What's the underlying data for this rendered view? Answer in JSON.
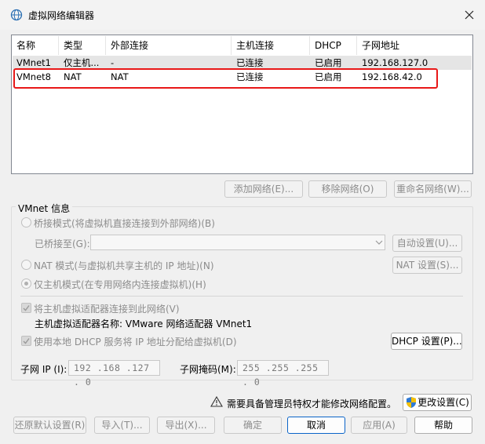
{
  "window": {
    "title": "虚拟网络编辑器"
  },
  "table": {
    "headers": [
      "名称",
      "类型",
      "外部连接",
      "主机连接",
      "DHCP",
      "子网地址"
    ],
    "rows": [
      [
        "VMnet1",
        "仅主机...",
        "-",
        "已连接",
        "已启用",
        "192.168.127.0"
      ],
      [
        "VMnet8",
        "NAT",
        "NAT",
        "已连接",
        "已启用",
        "192.168.42.0"
      ]
    ]
  },
  "table_buttons": {
    "add": "添加网络(E)...",
    "remove": "移除网络(O)",
    "rename": "重命名网络(W)..."
  },
  "vmnet_info": {
    "group_label": "VMnet 信息",
    "bridge_label": "桥接模式(将虚拟机直接连接到外部网络)(B)",
    "bridged_to_label": "已桥接至(G):",
    "bridged_to_value": "",
    "auto_settings": "自动设置(U)...",
    "nat_label": "NAT 模式(与虚拟机共享主机的 IP 地址)(N)",
    "nat_settings": "NAT 设置(S)...",
    "hostonly_label": "仅主机模式(在专用网络内连接虚拟机)(H)",
    "connect_adapter_label": "将主机虚拟适配器连接到此网络(V)",
    "adapter_name": "主机虚拟适配器名称: VMware 网络适配器 VMnet1",
    "dhcp_label": "使用本地 DHCP 服务将 IP 地址分配给虚拟机(D)",
    "dhcp_settings": "DHCP 设置(P)...",
    "subnet_ip_label": "子网 IP (I):",
    "subnet_ip_value": "192 .168 .127 . 0",
    "subnet_mask_label": "子网掩码(M):",
    "subnet_mask_value": "255 .255 .255 . 0"
  },
  "admin_notice": {
    "text": "需要具备管理员特权才能修改网络配置。",
    "change_settings": "更改设置(C)"
  },
  "footer": {
    "restore": "还原默认设置(R)",
    "import": "导入(T)...",
    "export": "导出(X)...",
    "ok": "确定",
    "cancel": "取消",
    "apply": "应用(A)",
    "help": "帮助"
  },
  "selection": {
    "selected_row": "VMnet1",
    "highlighted_row": "VMnet8"
  },
  "colors": {
    "highlight_box": "#e81818",
    "default_button_border": "#0a64c8"
  }
}
